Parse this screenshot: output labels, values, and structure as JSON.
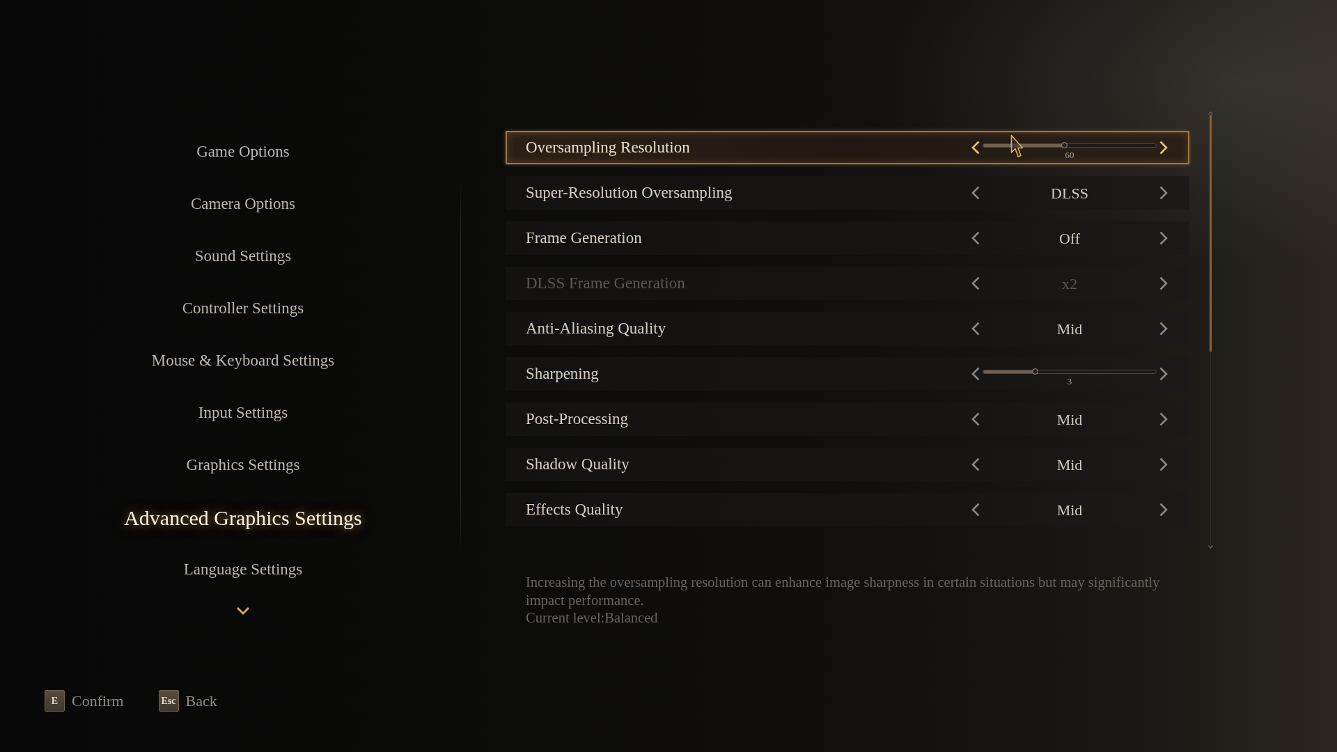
{
  "menu": [
    {
      "label": "Game Options",
      "selected": false
    },
    {
      "label": "Camera Options",
      "selected": false
    },
    {
      "label": "Sound Settings",
      "selected": false
    },
    {
      "label": "Controller Settings",
      "selected": false
    },
    {
      "label": "Mouse & Keyboard Settings",
      "selected": false
    },
    {
      "label": "Input Settings",
      "selected": false
    },
    {
      "label": "Graphics Settings",
      "selected": false
    },
    {
      "label": "Advanced Graphics Settings",
      "selected": true
    },
    {
      "label": "Language Settings",
      "selected": false
    }
  ],
  "settings": [
    {
      "kind": "slider",
      "label": "Oversampling Resolution",
      "level": 0.47,
      "reading": "60",
      "selected": true,
      "disabled": false
    },
    {
      "kind": "choice",
      "label": "Super-Resolution Oversampling",
      "value": "DLSS",
      "selected": false,
      "disabled": false
    },
    {
      "kind": "choice",
      "label": "Frame Generation",
      "value": "Off",
      "selected": false,
      "disabled": false
    },
    {
      "kind": "choice",
      "label": "DLSS Frame Generation",
      "value": "x2",
      "selected": false,
      "disabled": true
    },
    {
      "kind": "choice",
      "label": "Anti-Aliasing Quality",
      "value": "Mid",
      "selected": false,
      "disabled": false
    },
    {
      "kind": "slider",
      "label": "Sharpening",
      "level": 0.3,
      "reading": "3",
      "selected": false,
      "disabled": false
    },
    {
      "kind": "choice",
      "label": "Post-Processing",
      "value": "Mid",
      "selected": false,
      "disabled": false
    },
    {
      "kind": "choice",
      "label": "Shadow Quality",
      "value": "Mid",
      "selected": false,
      "disabled": false
    },
    {
      "kind": "choice",
      "label": "Effects Quality",
      "value": "Mid",
      "selected": false,
      "disabled": false
    }
  ],
  "description": {
    "text": "Increasing the oversampling resolution can enhance image sharpness in certain situations but may significantly impact performance.",
    "current_level": "Current level:Balanced"
  },
  "hints": [
    {
      "key": "E",
      "label": "Confirm"
    },
    {
      "key": "Esc",
      "label": "Back"
    }
  ]
}
